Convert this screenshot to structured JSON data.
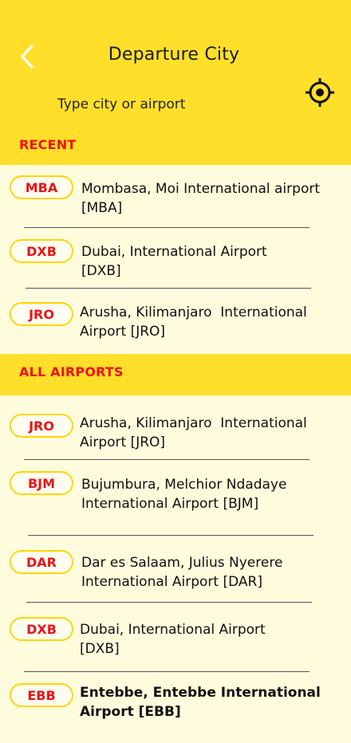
{
  "header": {
    "title": "Departure City",
    "search_placeholder": "Type city or airport",
    "back_icon": "chevron-left-icon",
    "locate_icon": "crosshair-locate-icon"
  },
  "colors": {
    "header_bg": "#FFDF2A",
    "list_bg": "#FFFCDD",
    "accent_red": "#EE1111",
    "pill_border": "#FFD500"
  },
  "sections": {
    "recent_label": "RECENT",
    "all_label": "ALL AIRPORTS"
  },
  "recent": [
    {
      "code": "MBA",
      "name": "Mombasa, Moi International airport\n[MBA]"
    },
    {
      "code": "DXB",
      "name": "Dubai, International Airport\n[DXB]"
    },
    {
      "code": "JRO",
      "name": "Arusha, Kilimanjaro  International\nAirport [JRO]"
    }
  ],
  "all": [
    {
      "code": "JRO",
      "name": "Arusha, Kilimanjaro  International\nAirport [JRO]"
    },
    {
      "code": "BJM",
      "name": "Bujumbura, Melchior Ndadaye\nInternational Airport [BJM]"
    },
    {
      "code": "DAR",
      "name": "Dar es Salaam, Julius Nyerere\nInternational Airport [DAR]"
    },
    {
      "code": "DXB",
      "name": "Dubai, International Airport\n[DXB]"
    },
    {
      "code": "EBB",
      "name": "Entebbe, Entebbe International\nAirport [EBB]"
    }
  ]
}
